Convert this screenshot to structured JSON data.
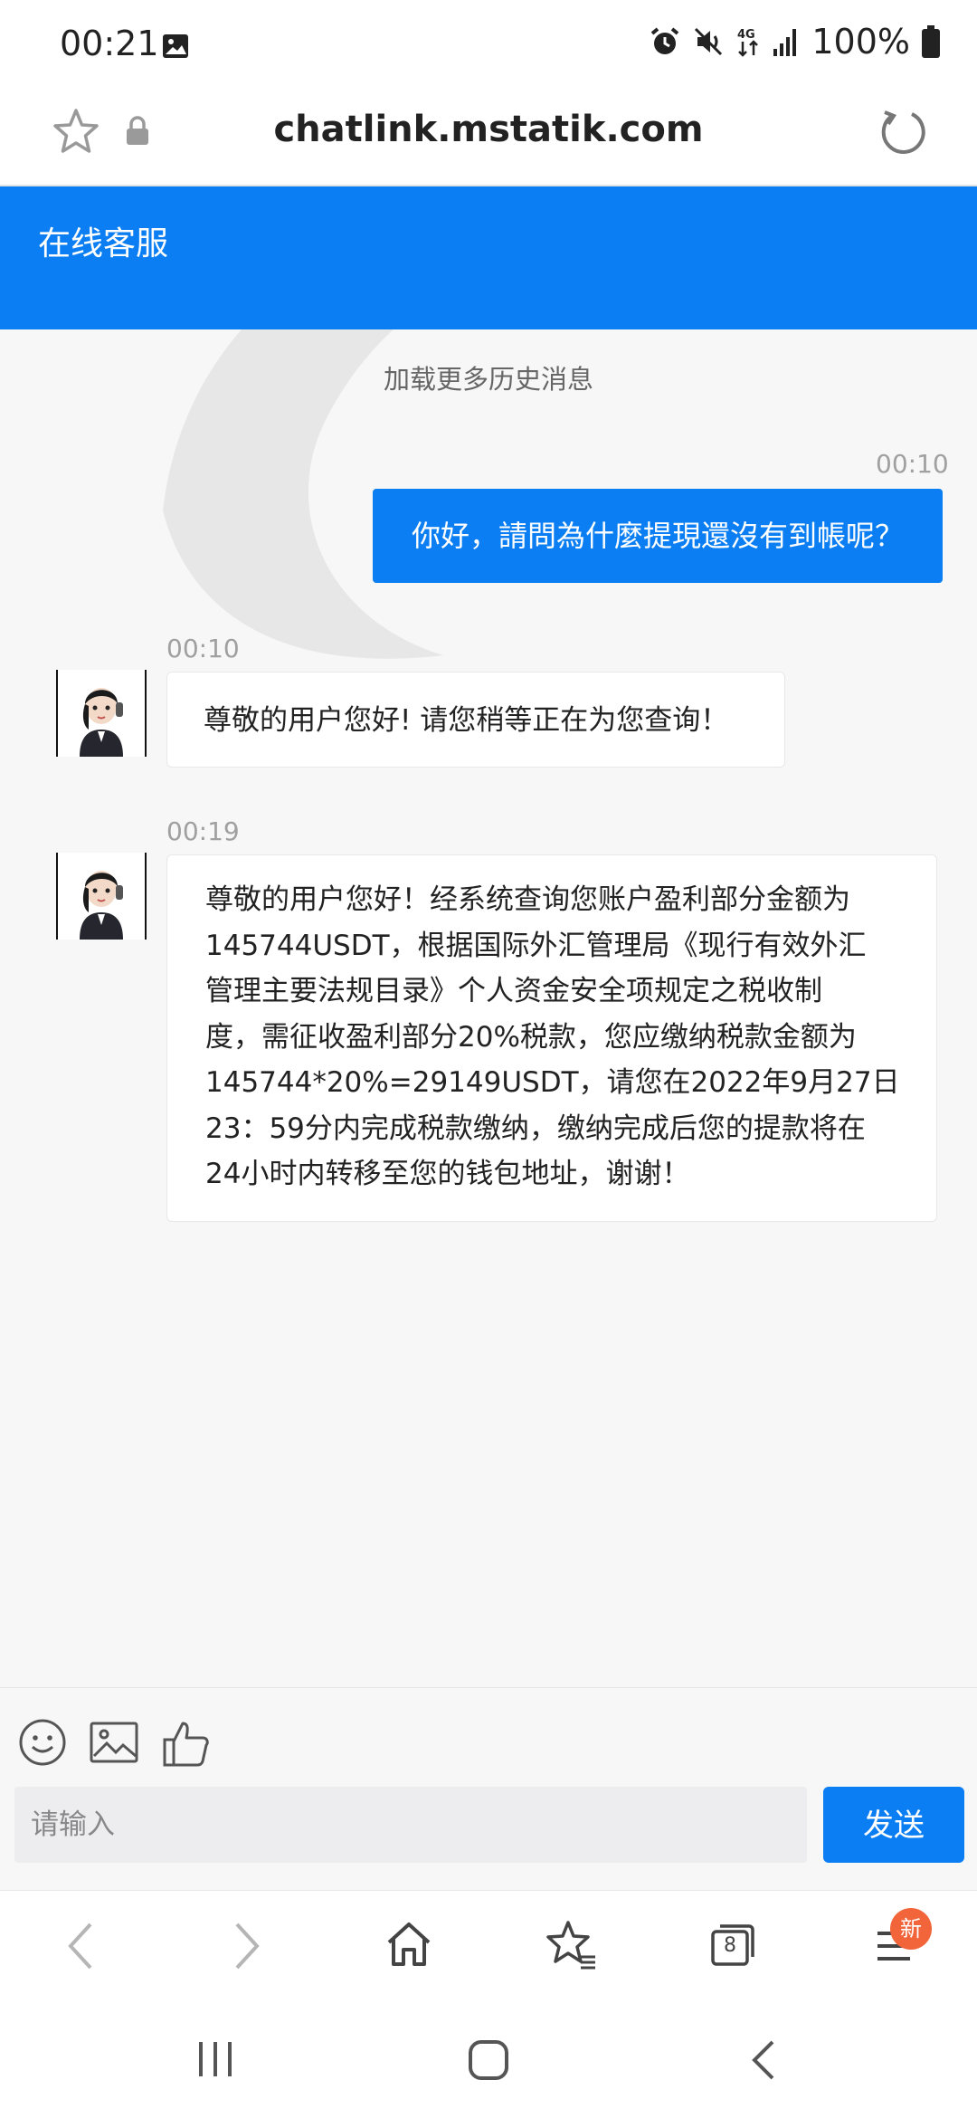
{
  "status_bar": {
    "time": "00:21",
    "battery_percent": "100%",
    "network": "4G",
    "icons": [
      "image-icon",
      "alarm-icon",
      "mute-icon",
      "data-4g-icon",
      "signal-icon",
      "battery-icon"
    ]
  },
  "browser": {
    "url": "chatlink.mstatik.com",
    "open_tabs": "8",
    "menu_badge": "新"
  },
  "chat": {
    "title": "在线客服",
    "load_more": "加载更多历史消息",
    "messages": [
      {
        "direction": "out",
        "time": "00:10",
        "text": "你好，請問為什麼提現還沒有到帳呢？"
      },
      {
        "direction": "in",
        "time": "00:10",
        "text": "尊敬的用户您好! 请您稍等正在为您查询！"
      },
      {
        "direction": "in",
        "time": "00:19",
        "lines": [
          "尊敬的用户您好！经系统查询您账户盈利部分金额为",
          "145744USDT，根据国际外汇管理局《现行有效外汇",
          "管理主要法规目录》个人资金安全项规定之税收制",
          "度，需征收盈利部分20%税款，您应缴纳税款金额为",
          "145744*20%=29149USDT，请您在2022年9月27日",
          "23：59分内完成税款缴纳，缴纳完成后您的提款将在",
          "24小时内转移至您的钱包地址，谢谢！"
        ]
      }
    ]
  },
  "composer": {
    "placeholder": "请输入",
    "value": "",
    "send_label": "发送"
  },
  "colors": {
    "accent": "#0a7ef2",
    "badge": "#f2653a",
    "background": "#f7f7f8"
  }
}
